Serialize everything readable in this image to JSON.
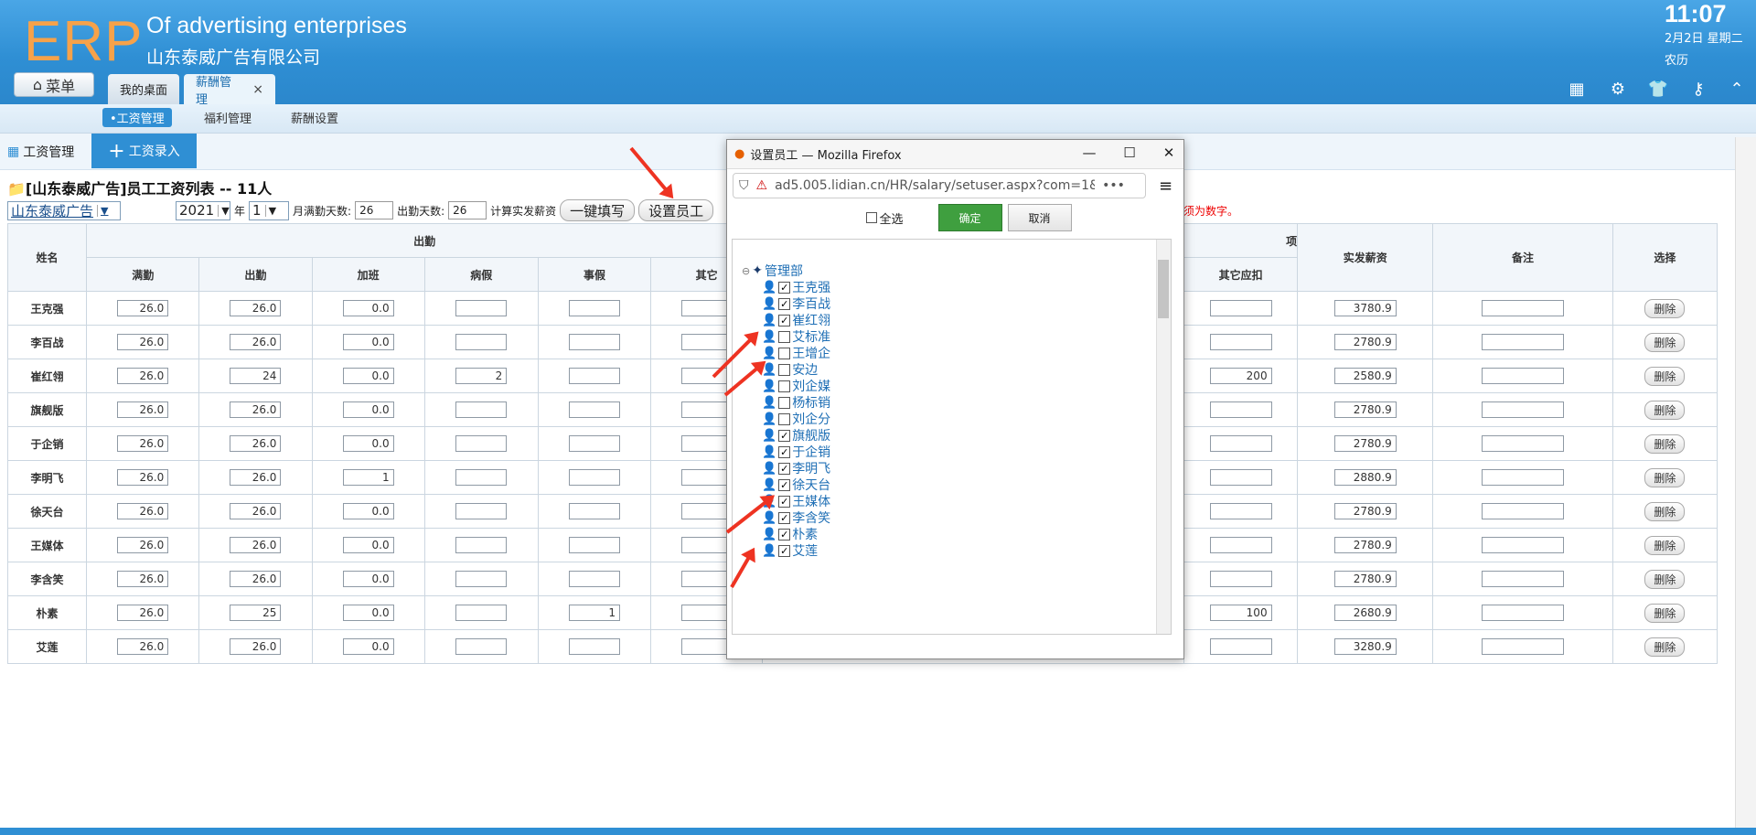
{
  "header": {
    "logo": "ERP",
    "slogan": "Of advertising enterprises",
    "company": "山东泰威广告有限公司",
    "time": "11:07",
    "date": "2月2日 星期二",
    "lunar": "农历"
  },
  "menu": {
    "label": "菜单"
  },
  "tabs": [
    {
      "label": "我的桌面"
    },
    {
      "label": "薪酬管理",
      "close": "×"
    }
  ],
  "subtabs": [
    {
      "label": "•工资管理"
    },
    {
      "label": "福利管理"
    },
    {
      "label": "薪酬设置"
    }
  ],
  "toolbar": {
    "module": "工资管理",
    "add_label": "工资录入"
  },
  "list": {
    "title": "[山东泰威广告]员工工资列表 -- 11人",
    "company_select": "山东泰威广告",
    "year": "2021",
    "year_unit": "年",
    "month": "1",
    "month_unit": "月满勤天数:",
    "full_days": "26",
    "attend_label": "出勤天数:",
    "attend_days": "26",
    "calc_label": "计算实发薪资",
    "fill_btn": "一键填写",
    "set_btn": "设置员工",
    "warn": "必须为数字。"
  },
  "grid": {
    "headers": {
      "name": "姓名",
      "attendance": "出勤",
      "full": "满勤",
      "present": "出勤",
      "overtime": "加班",
      "sick": "病假",
      "personal": "事假",
      "other": "其它",
      "other_ded": "其它应扣",
      "net": "实发薪资",
      "note": "备注",
      "select": "选择",
      "tail": "项"
    },
    "delete_label": "删除",
    "rows": [
      {
        "name": "王克强",
        "full": "26.0",
        "present": "26.0",
        "ot": "0.0",
        "sick": "",
        "personal": "",
        "other_ded": "",
        "net": "3780.9"
      },
      {
        "name": "李百战",
        "full": "26.0",
        "present": "26.0",
        "ot": "0.0",
        "sick": "",
        "personal": "",
        "other_ded": "",
        "net": "2780.9"
      },
      {
        "name": "崔红翎",
        "full": "26.0",
        "present": "24",
        "ot": "0.0",
        "sick": "2",
        "personal": "",
        "other_ded": "200",
        "net": "2580.9"
      },
      {
        "name": "旗舰版",
        "full": "26.0",
        "present": "26.0",
        "ot": "0.0",
        "sick": "",
        "personal": "",
        "other_ded": "",
        "net": "2780.9"
      },
      {
        "name": "于企销",
        "full": "26.0",
        "present": "26.0",
        "ot": "0.0",
        "sick": "",
        "personal": "",
        "other_ded": "",
        "net": "2780.9"
      },
      {
        "name": "李明飞",
        "full": "26.0",
        "present": "26.0",
        "ot": "1",
        "sick": "",
        "personal": "",
        "other_ded": "",
        "net": "2880.9"
      },
      {
        "name": "徐天台",
        "full": "26.0",
        "present": "26.0",
        "ot": "0.0",
        "sick": "",
        "personal": "",
        "other_ded": "",
        "net": "2780.9"
      },
      {
        "name": "王媒体",
        "full": "26.0",
        "present": "26.0",
        "ot": "0.0",
        "sick": "",
        "personal": "",
        "other_ded": "",
        "net": "2780.9"
      },
      {
        "name": "李含笑",
        "full": "26.0",
        "present": "26.0",
        "ot": "0.0",
        "sick": "",
        "personal": "",
        "other_ded": "",
        "net": "2780.9"
      },
      {
        "name": "朴素",
        "full": "26.0",
        "present": "25",
        "ot": "0.0",
        "sick": "",
        "personal": "1",
        "other_ded": "100",
        "net": "2680.9"
      },
      {
        "name": "艾莲",
        "full": "26.0",
        "present": "26.0",
        "ot": "0.0",
        "sick": "",
        "personal": "",
        "other_ded": "",
        "net": "3280.9"
      }
    ]
  },
  "popup": {
    "title": "设置员工 — Mozilla Firefox",
    "url": "ad5.005.lidian.cn/HR/salary/setuser.aspx?com=1&Ra",
    "url_host": "lidian.cn",
    "select_all": "全选",
    "ok": "确定",
    "cancel": "取消",
    "dept": "管理部",
    "employees": [
      {
        "name": "王克强",
        "checked": true
      },
      {
        "name": "李百战",
        "checked": true
      },
      {
        "name": "崔红翎",
        "checked": true
      },
      {
        "name": "艾标准",
        "checked": false
      },
      {
        "name": "王增企",
        "checked": false
      },
      {
        "name": "安边",
        "checked": false
      },
      {
        "name": "刘企媒",
        "checked": false
      },
      {
        "name": "杨标销",
        "checked": false
      },
      {
        "name": "刘企分",
        "checked": false
      },
      {
        "name": "旗舰版",
        "checked": true
      },
      {
        "name": "于企销",
        "checked": true
      },
      {
        "name": "李明飞",
        "checked": true
      },
      {
        "name": "徐天台",
        "checked": true
      },
      {
        "name": "王媒体",
        "checked": true
      },
      {
        "name": "李含笑",
        "checked": true
      },
      {
        "name": "朴素",
        "checked": true
      },
      {
        "name": "艾莲",
        "checked": true
      }
    ]
  },
  "colors": {
    "brand": "#2f8fd4",
    "logo": "#f6a24a",
    "annotation": "#ee3322",
    "ok": "#3f9f3f"
  }
}
